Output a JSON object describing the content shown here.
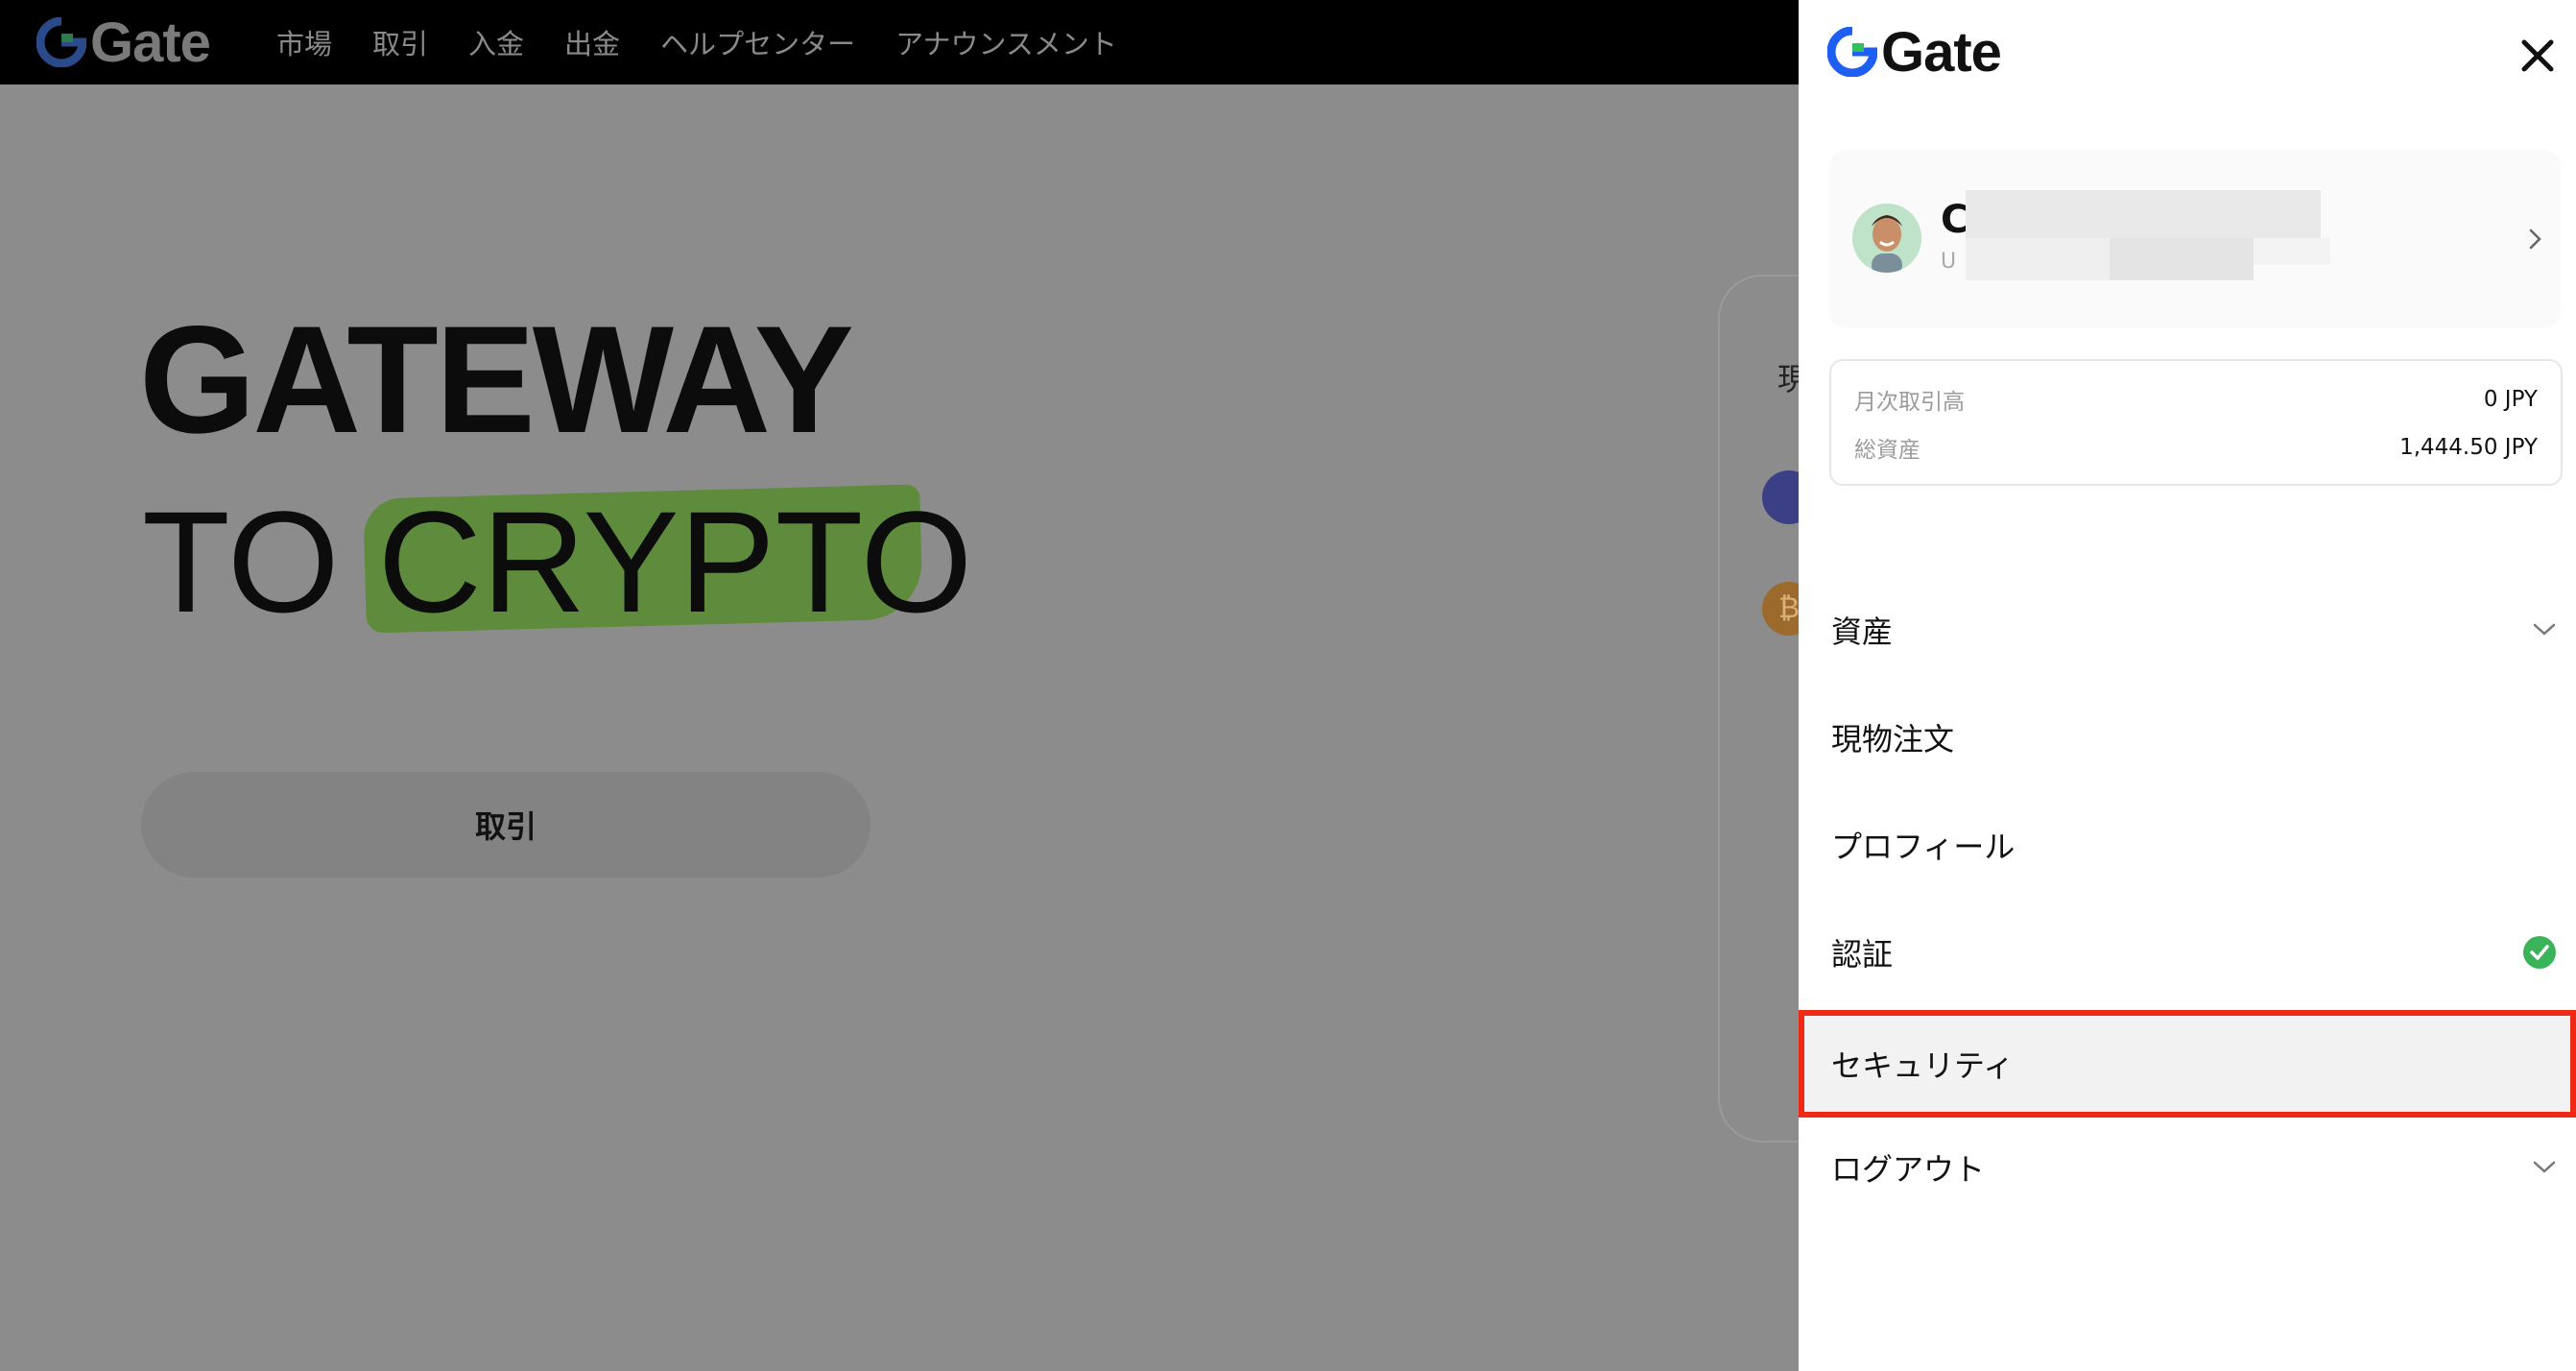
{
  "background": {
    "brand": "Gate",
    "nav": [
      "市場",
      "取引",
      "入金",
      "出金",
      "ヘルプセンター",
      "アナウンスメント"
    ],
    "hero": {
      "line1": "GATEWAY",
      "line2_prefix": "TO",
      "line2_highlight": "CRYPTO"
    },
    "trade_button": "取引",
    "card_label": "現"
  },
  "drawer": {
    "brand": "Gate",
    "close_icon": "close-icon",
    "profile": {
      "name_initial": "C",
      "sub_initial": "U",
      "chevron_icon": "chevron-right-icon"
    },
    "stats": [
      {
        "label": "月次取引高",
        "value": "0 JPY"
      },
      {
        "label": "総資産",
        "value": "1,444.50 JPY"
      }
    ],
    "menu": [
      {
        "label": "資産",
        "trail": "chevron-down-icon"
      },
      {
        "label": "現物注文",
        "trail": ""
      },
      {
        "label": "プロフィール",
        "trail": ""
      },
      {
        "label": "認証",
        "trail": "check-circle-icon"
      },
      {
        "label": "セキュリティ",
        "trail": ""
      },
      {
        "label": "ログアウト",
        "trail": "chevron-down-icon"
      }
    ],
    "selected_item": "セキュリティ"
  },
  "colors": {
    "brand_blue": "#1f5ef3",
    "brand_green": "#2ec15d",
    "highlight_red": "#ee2a16",
    "verified_green": "#3bb35a"
  }
}
